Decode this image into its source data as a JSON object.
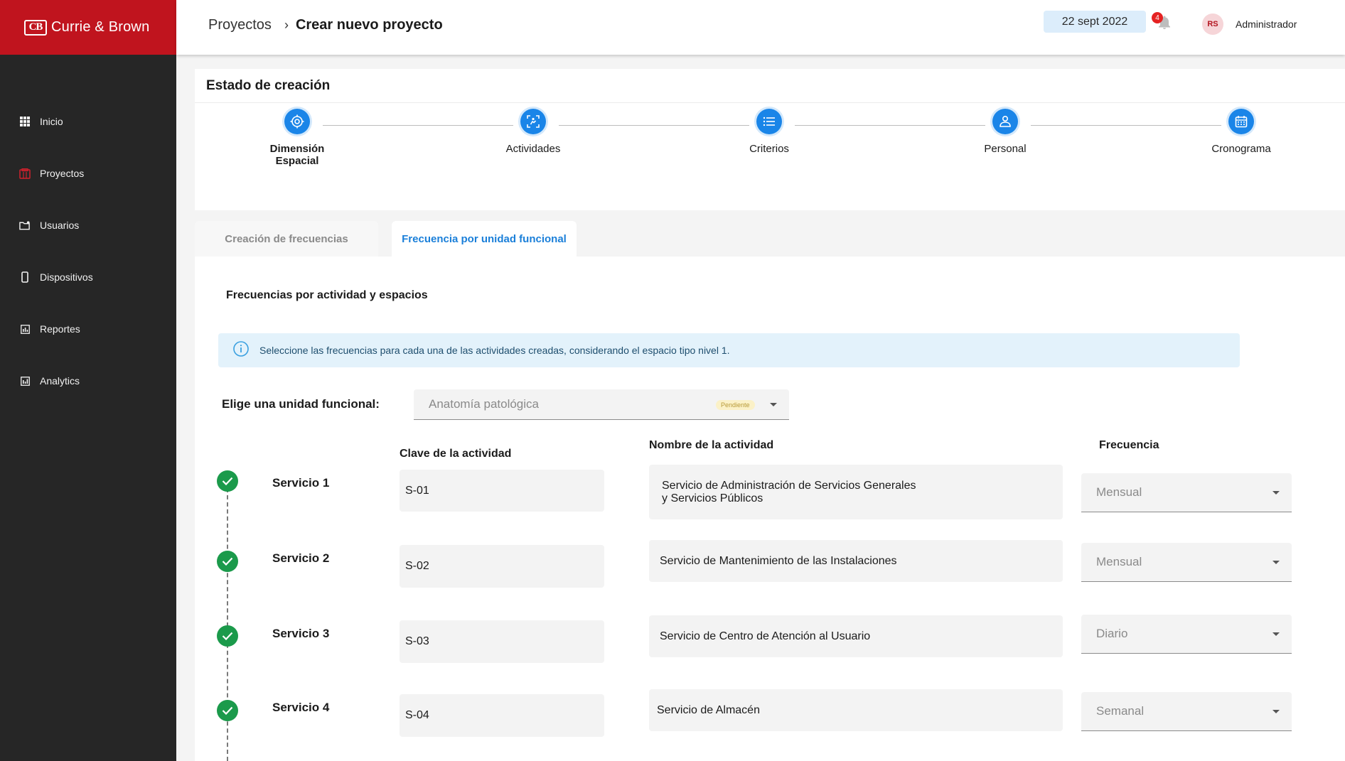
{
  "brand": {
    "mark": "CB",
    "name": "Currie & Brown",
    "color": "#c0141e"
  },
  "sidebar": {
    "items": [
      {
        "label": "Inicio",
        "icon": "grid-icon"
      },
      {
        "label": "Proyectos",
        "icon": "projects-icon"
      },
      {
        "label": "Usuarios",
        "icon": "users-folder-icon"
      },
      {
        "label": "Dispositivos",
        "icon": "device-icon"
      },
      {
        "label": "Reportes",
        "icon": "report-icon"
      },
      {
        "label": "Analytics",
        "icon": "analytics-icon"
      }
    ]
  },
  "header": {
    "breadcrumb_parent": "Proyectos",
    "breadcrumb_separator": "›",
    "breadcrumb_current": "Crear nuevo proyecto",
    "date": "22 sept 2022",
    "notification_count": "4",
    "avatar_initials": "RS",
    "user_name": "Administrador"
  },
  "stepper": {
    "title": "Estado de creación",
    "steps": [
      {
        "label": "Dimensión Espacial",
        "icon": "target-icon"
      },
      {
        "label": "Actividades",
        "icon": "activities-icon"
      },
      {
        "label": "Criterios",
        "icon": "list-icon"
      },
      {
        "label": "Personal",
        "icon": "people-icon"
      },
      {
        "label": "Cronograma",
        "icon": "calendar-icon"
      }
    ],
    "accent": "#1a85e8"
  },
  "tabs": [
    {
      "label": "Creación de frecuencias",
      "active": false
    },
    {
      "label": "Frecuencia por unidad funcional",
      "active": true
    }
  ],
  "main": {
    "section_title": "Frecuencias por actividad y espacios",
    "info_text": "Seleccione las frecuencias para cada una de las actividades creadas, considerando el espacio tipo nivel 1.",
    "unit_label": "Elige una unidad funcional:",
    "unit_value": "Anatomía patológica",
    "unit_badge": "Pendiente",
    "col_key": "Clave de la actividad",
    "col_name": "Nombre de la actividad",
    "col_freq": "Frecuencia",
    "services": [
      {
        "label": "Servicio 1",
        "key": "S-01",
        "name_line1": "Servicio de Administración de Servicios Generales",
        "name_line2": "y Servicios Públicos",
        "frequency": "Mensual"
      },
      {
        "label": "Servicio 2",
        "key": "S-02",
        "name_line1": "Servicio de Mantenimiento de las Instalaciones",
        "name_line2": "",
        "frequency": "Mensual"
      },
      {
        "label": "Servicio 3",
        "key": "S-03",
        "name_line1": "Servicio de Centro de Atención al Usuario",
        "name_line2": "",
        "frequency": "Diario"
      },
      {
        "label": "Servicio 4",
        "key": "S-04",
        "name_line1": "Servicio de Almacén",
        "name_line2": "",
        "frequency": "Semanal"
      }
    ],
    "status_color": "#1b9a4b"
  }
}
